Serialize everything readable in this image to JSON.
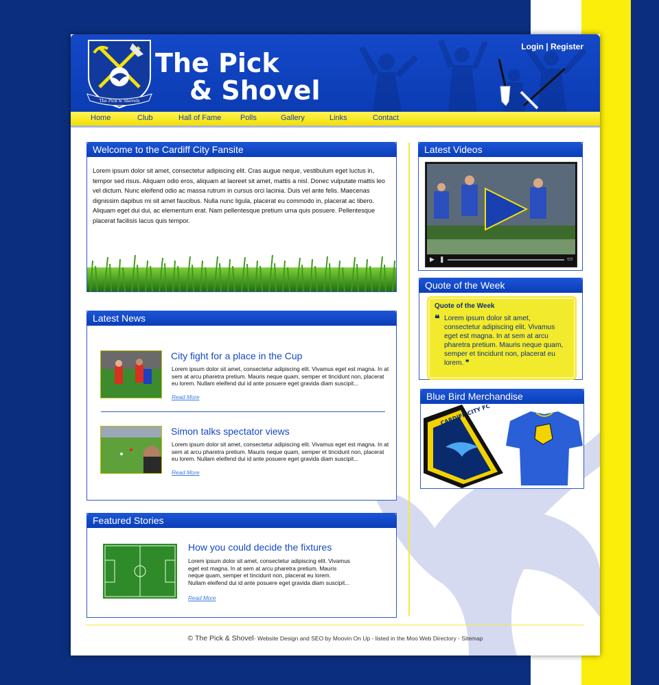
{
  "site": {
    "title_line1": "The Pick",
    "title_line2": "& Shovel",
    "crest_caption": "The Pick & Shovels"
  },
  "auth": {
    "login": "Login",
    "separator": "|",
    "register": "Register"
  },
  "nav": [
    "Home",
    "Club",
    "Hall of Fame",
    "Polls",
    "Gallery",
    "Links",
    "Contact"
  ],
  "welcome": {
    "heading": "Welcome to the Cardiff City Fansite",
    "body": "Lorem ipsum dolor sit amet, consectetur adipiscing elit. Cras augue neque, vestibulum eget luctus in, tempor sed risus. Aliquam odio eros, aliquam at laoreet sit amet, mattis a nisl. Donec vulputate mattis leo vel dictum. Nunc eleifend odio ac massa rutrum in cursus orci lacinia. Duis vel ante felis. Maecenas dignissim dapibus mi sit amet faucibus. Nulla nunc ligula, placerat eu commodo in, placerat ac libero. Aliquam eget dui dui, ac elementum erat. Nam pellentesque pretium urna quis posuere. Pellentesque placerat facilisis lacus quis tempor."
  },
  "news": {
    "heading": "Latest News",
    "items": [
      {
        "title": "City fight for a place in the Cup",
        "text": "Lorem ipsum dolor sit amet, consectetur adipiscing elit. Vivamus eget est magna. In at sem at arcu pharetra pretium. Mauris neque quam, semper et tincidunt non, placerat eu lorem. Nullam eleifend dui id ante posuere eget gravida diam suscipit...",
        "more": "Read More"
      },
      {
        "title": "Simon talks spectator views",
        "text": "Lorem ipsum dolor sit amet, consectetur adipiscing elit. Vivamus eget est magna. In at sem at arcu pharetra pretium. Mauris neque quam, semper et tincidunt non, placerat eu lorem. Nullam eleifend dui id ante posuere eget gravida diam suscipit...",
        "more": "Read More"
      }
    ]
  },
  "featured": {
    "heading": "Featured Stories",
    "title": "How you could decide the fixtures",
    "text": "Lorem ipsum dolor sit amet, consectetur adipiscing elit. Vivamus eget est magna. In at sem at arcu pharetra pretium. Mauris neque quam, semper et tincidunt non, placerat eu lorem. Nullam eleifend dui id ante posuere eget gravida diam suscipit...",
    "more": "Read More"
  },
  "videos": {
    "heading": "Latest Videos",
    "controls": [
      "play-icon",
      "pause-icon",
      "fullscreen-icon"
    ]
  },
  "quote": {
    "heading": "Quote of the Week",
    "inner_title": "Quote of the Week",
    "open_mark": "❝",
    "text": "Lorem ipsum dolor sit amet, consectetur adipiscing elit. Vivamus eget est magna. In at sem at arcu pharetra pretium. Mauris neque quam, semper et tincidunt non, placerat eu lorem.",
    "close_mark": "❞"
  },
  "merch": {
    "heading": "Blue Bird Merchandise",
    "badge_text": "CARDIFF CITY FC"
  },
  "footer": {
    "brand": "© The Pick & Shovel",
    "credits": "- Website Design and SEO by Moovin On Up - listed in the Moo Web Directory - Sitemap"
  },
  "colors": {
    "brand_blue": "#0b3cb4",
    "page_bg": "#0b2f7e",
    "accent_yellow": "#fbee0a",
    "link_blue": "#1447c6"
  }
}
